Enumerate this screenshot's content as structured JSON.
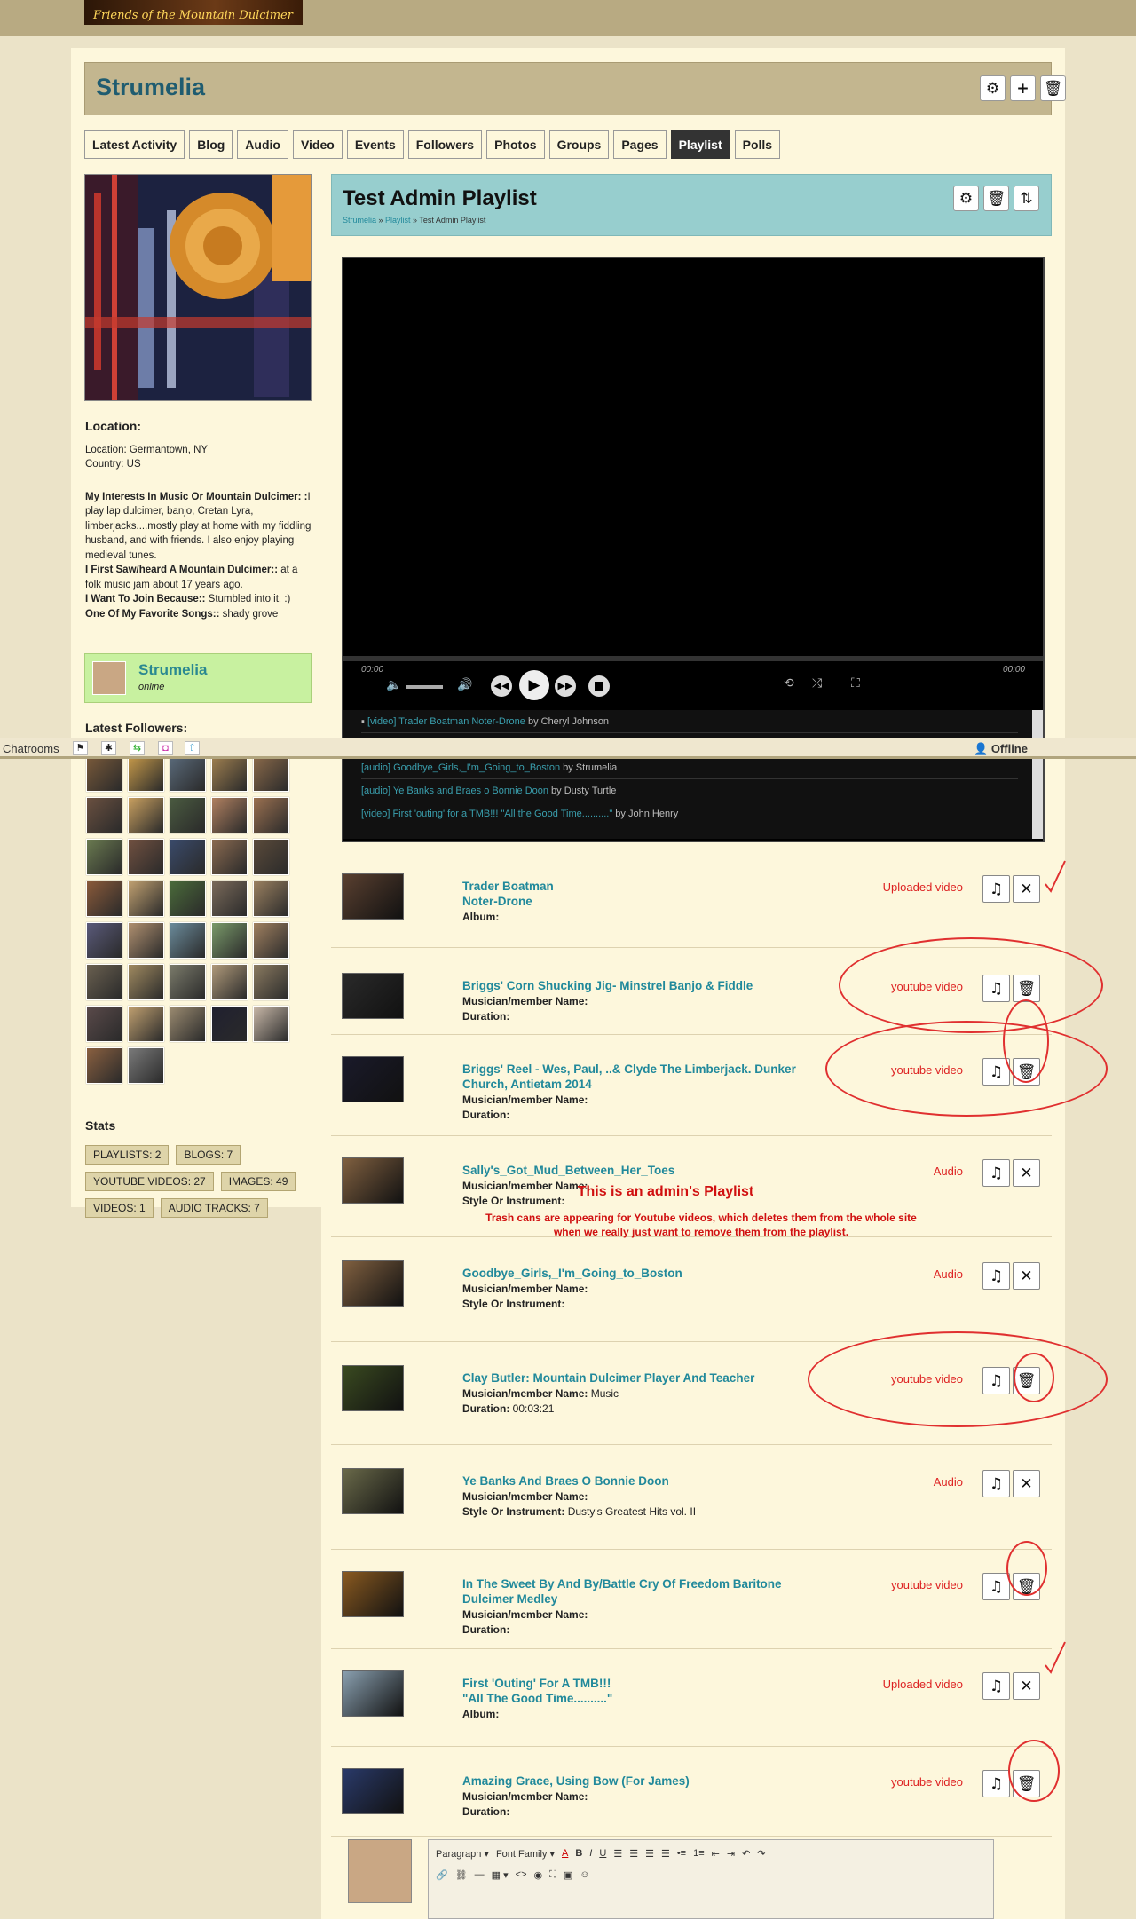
{
  "banner": {
    "text": "Friends of the Mountain Dulcimer"
  },
  "header": {
    "title": "Strumelia"
  },
  "tabs": [
    "Latest Activity",
    "Blog",
    "Audio",
    "Video",
    "Events",
    "Followers",
    "Photos",
    "Groups",
    "Pages",
    "Playlist",
    "Polls"
  ],
  "sidebar": {
    "location_h": "Location:",
    "location": "Location: Germantown, NY",
    "country": "Country: US",
    "int1_label": "My Interests In Music Or Mountain Dulcimer: :",
    "int1_text": "I play lap dulcimer, banjo, Cretan Lyra, limberjacks....mostly play at home with my fiddling husband, and with friends. I also enjoy playing medieval tunes.",
    "int2_label": "I First Saw/heard A Mountain Dulcimer::",
    "int2_text": "at a folk music jam about 17 years ago.",
    "int3_label": "I Want To Join Because::",
    "int3_text": "Stumbled into it. :)",
    "int4_label": "One Of My Favorite Songs::",
    "int4_text": "shady grove",
    "online_name": "Strumelia",
    "online_status": "online",
    "followers_h": "Latest Followers:",
    "stats_h": "Stats",
    "stats": [
      "PLAYLISTS: 2",
      "BLOGS: 7",
      "YOUTUBE VIDEOS: 27",
      "IMAGES: 49",
      "VIDEOS: 1",
      "AUDIO TRACKS: 7"
    ]
  },
  "chatbar": {
    "label": "Chatrooms",
    "status": "Offline"
  },
  "playlist": {
    "title": "Test Admin Playlist",
    "crumb1": "Strumelia",
    "crumb2": "Playlist",
    "crumb3": "Test Admin Playlist",
    "time_start": "00:00",
    "time_end": "00:00",
    "queue": [
      {
        "t": "[video] Trader Boatman Noter-Drone",
        "by": " by Cheryl Johnson"
      },
      {
        "t": "[audio] Goodbye_Girls,_I'm_Going_to_Boston",
        "by": " by Strumelia"
      },
      {
        "t": "[audio] Ye Banks and Braes o Bonnie Doon",
        "by": " by Dusty Turtle"
      },
      {
        "t": "[video] First 'outing' for a TMB!!! \"All the Good Time..........\"",
        "by": " by John Henry"
      }
    ]
  },
  "items": [
    {
      "title": "Trader Boatman\nNoter-Drone",
      "m1k": "Album:",
      "m1v": "",
      "m2k": "",
      "m2v": "",
      "type": "Uploaded video",
      "action": "✕"
    },
    {
      "title": "Briggs' Corn Shucking Jig- Minstrel Banjo & Fiddle",
      "m1k": "Musician/member Name:",
      "m1v": "",
      "m2k": "Duration:",
      "m2v": "",
      "type": "youtube video",
      "action": "🗑"
    },
    {
      "title": "Briggs' Reel - Wes, Paul, ..& Clyde The Limberjack. Dunker Church, Antietam 2014",
      "m1k": "Musician/member Name:",
      "m1v": "",
      "m2k": "Duration:",
      "m2v": "",
      "type": "youtube video",
      "action": "🗑"
    },
    {
      "title": "Sally's_Got_Mud_Between_Her_Toes",
      "m1k": "Musician/member Name:",
      "m1v": "",
      "m2k": "Style Or Instrument:",
      "m2v": "",
      "type": "Audio",
      "action": "✕"
    },
    {
      "title": "Goodbye_Girls,_I'm_Going_to_Boston",
      "m1k": "Musician/member Name:",
      "m1v": "",
      "m2k": "Style Or Instrument:",
      "m2v": "",
      "type": "Audio",
      "action": "✕"
    },
    {
      "title": "Clay Butler: Mountain Dulcimer Player And Teacher",
      "m1k": "Musician/member Name:",
      "m1v": " Music",
      "m2k": "Duration:",
      "m2v": " 00:03:21",
      "type": "youtube video",
      "action": "🗑"
    },
    {
      "title": "Ye Banks And Braes O Bonnie Doon",
      "m1k": "Musician/member Name:",
      "m1v": "",
      "m2k": "Style Or Instrument:",
      "m2v": " Dusty's Greatest Hits vol. II",
      "type": "Audio",
      "action": "✕"
    },
    {
      "title": "In The Sweet By And By/Battle Cry Of Freedom Baritone Dulcimer Medley",
      "m1k": "Musician/member Name:",
      "m1v": "",
      "m2k": "Duration:",
      "m2v": "",
      "type": "youtube video",
      "action": "🗑"
    },
    {
      "title": "First 'Outing' For A TMB!!!\n\"All The Good Time..........\"",
      "m1k": "Album:",
      "m1v": "",
      "m2k": "",
      "m2v": "",
      "type": "Uploaded video",
      "action": "✕"
    },
    {
      "title": "Amazing Grace, Using Bow (For James)",
      "m1k": "Musician/member Name:",
      "m1v": "",
      "m2k": "Duration:",
      "m2v": "",
      "type": "youtube video",
      "action": "🗑"
    }
  ],
  "annotation": {
    "line1": "This is an admin's Playlist",
    "line2": "Trash cans are appearing for Youtube videos, which deletes them from the whole site",
    "line3": "when we really just want to remove them from the playlist."
  },
  "editor": {
    "format": "Paragraph",
    "font": "Font Family"
  }
}
